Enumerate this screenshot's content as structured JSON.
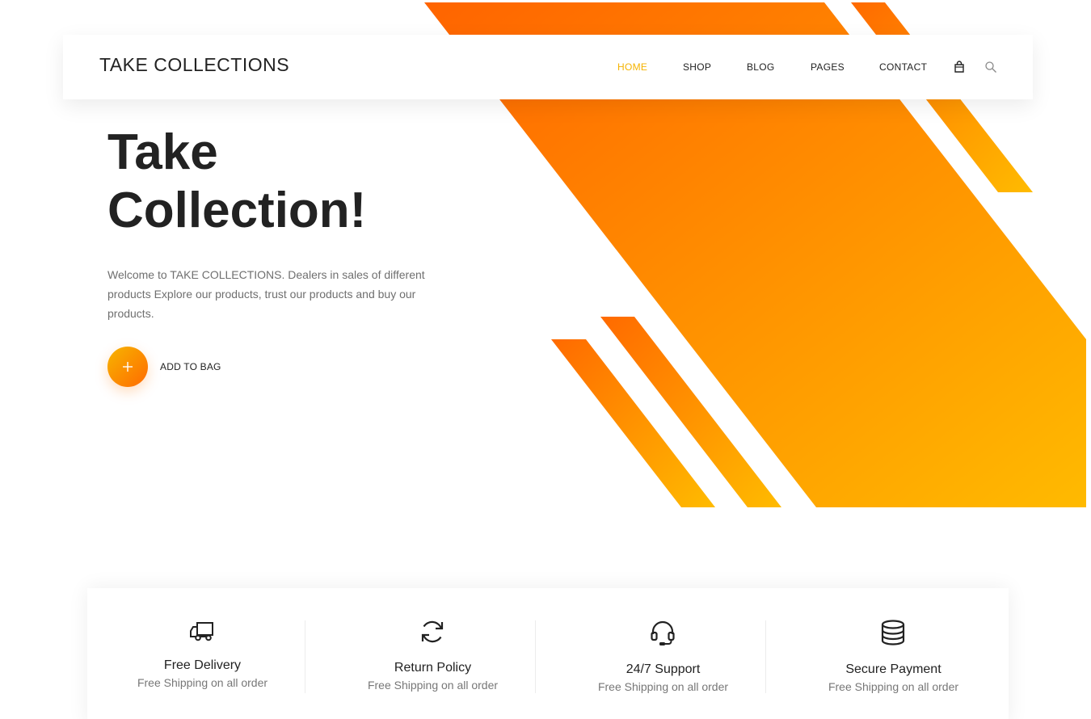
{
  "colors": {
    "accent_orange": "#ff6a00",
    "accent_yellow": "#ffb800",
    "active_nav": "#f5b300"
  },
  "header": {
    "brand": "TAKE COLLECTIONS",
    "nav": [
      {
        "label": "HOME",
        "active": true
      },
      {
        "label": "SHOP",
        "active": false
      },
      {
        "label": "BLOG",
        "active": false
      },
      {
        "label": "PAGES",
        "active": false
      },
      {
        "label": "CONTACT",
        "active": false
      }
    ],
    "icons": [
      "shopping-bag-icon",
      "search-icon"
    ]
  },
  "hero": {
    "title_line1": "Take",
    "title_line2": "Collection!",
    "description": "Welcome to TAKE COLLECTIONS. Dealers in sales of different products Explore our products, trust our products and buy our products.",
    "cta_icon": "plus-icon",
    "cta_label": "ADD TO BAG"
  },
  "features": [
    {
      "icon": "truck-icon",
      "title": "Free Delivery",
      "subtitle": "Free Shipping on all order"
    },
    {
      "icon": "refresh-icon",
      "title": "Return Policy",
      "subtitle": "Free Shipping on all order"
    },
    {
      "icon": "headset-icon",
      "title": "24/7 Support",
      "subtitle": "Free Shipping on all order"
    },
    {
      "icon": "database-icon",
      "title": "Secure Payment",
      "subtitle": "Free Shipping on all order"
    }
  ]
}
